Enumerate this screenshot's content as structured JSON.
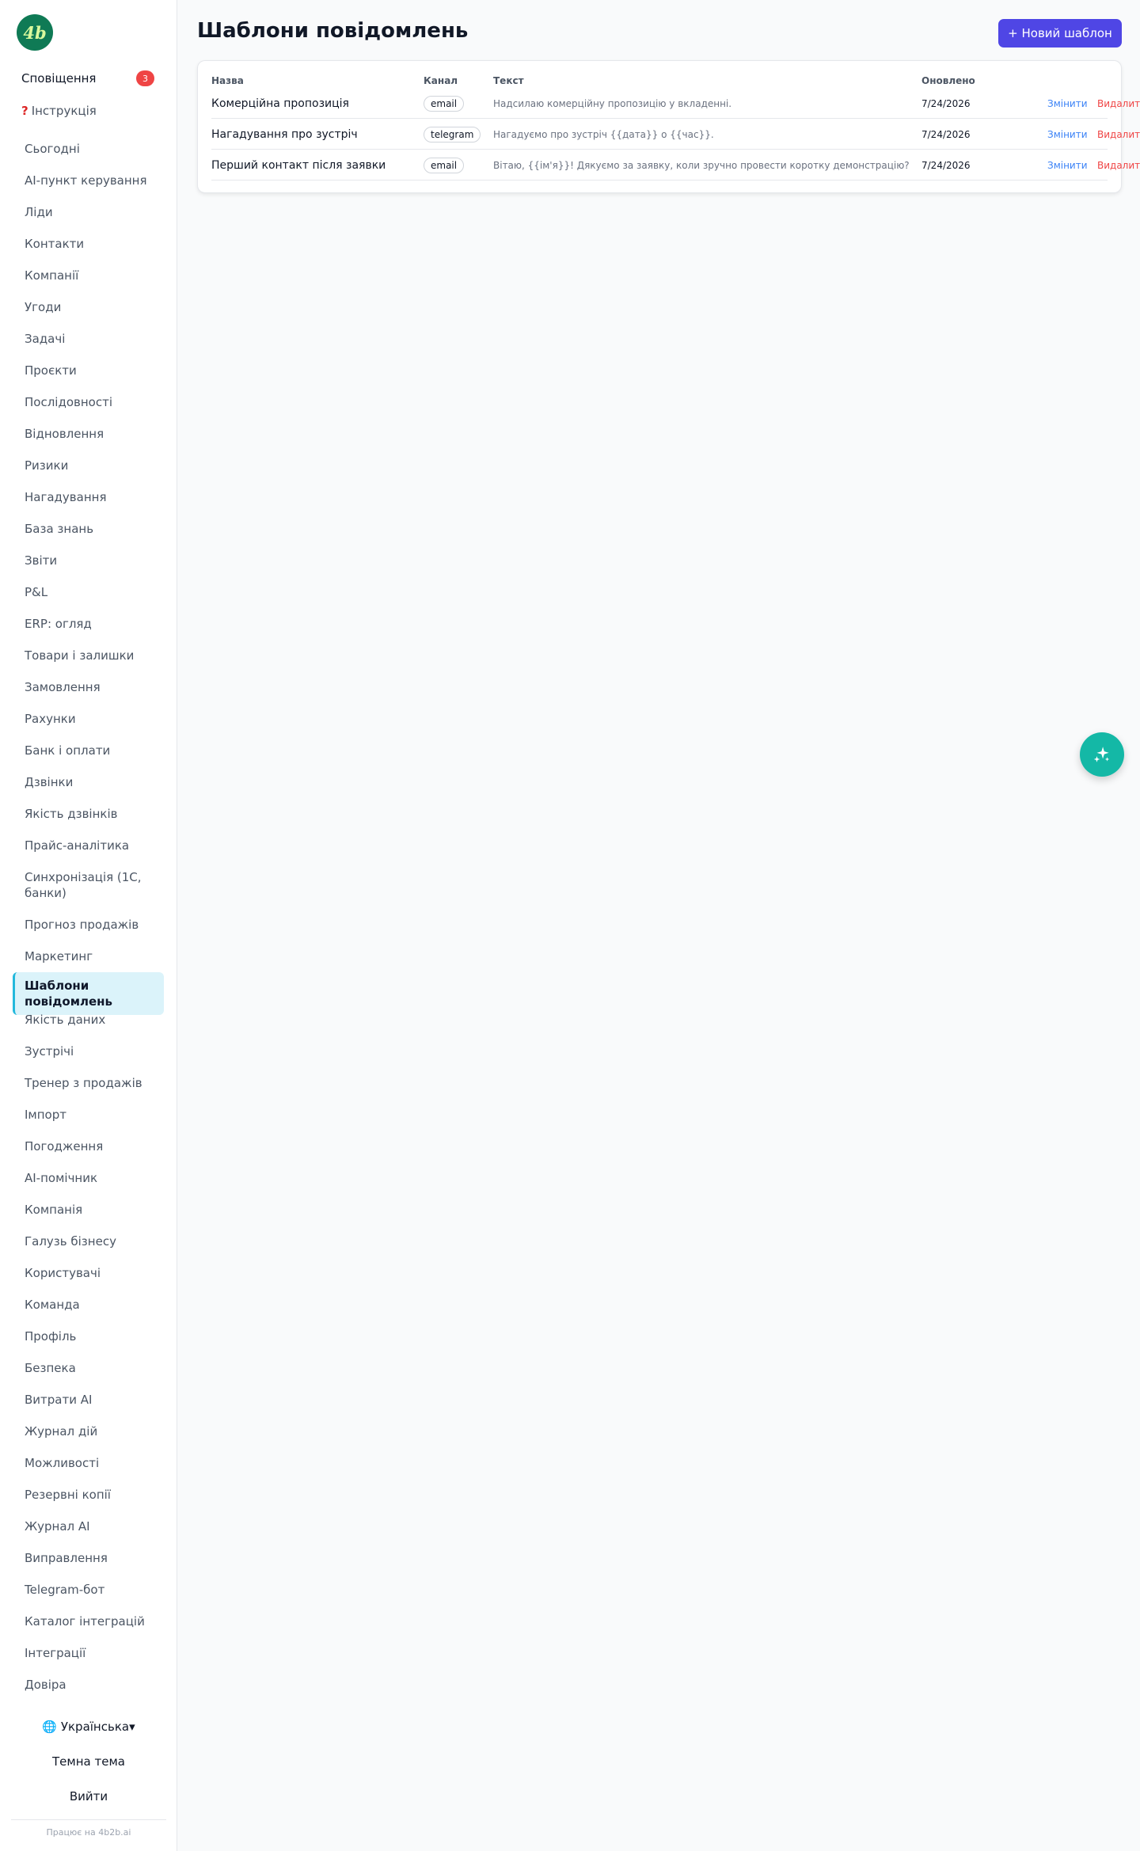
{
  "logo": {
    "text": "4b"
  },
  "sidebar": {
    "notifications": {
      "label": "Сповіщення",
      "count": "3"
    },
    "instruction": {
      "icon": "question-icon",
      "label": "Інструкція"
    },
    "items": [
      "Сьогодні",
      "AI-пункт керування",
      "Ліди",
      "Контакти",
      "Компанії",
      "Угоди",
      "Задачі",
      "Проєкти",
      "Послідовності",
      "Відновлення",
      "Ризики",
      "Нагадування",
      "База знань",
      "Звіти",
      "P&L",
      "ERP: огляд",
      "Товари і залишки",
      "Замовлення",
      "Рахунки",
      "Банк і оплати",
      "Дзвінки",
      "Якість дзвінків",
      "Прайс-аналітика",
      "Синхронізація (1С, банки)",
      "Прогноз продажів",
      "Маркетинг",
      "Шаблони повідомлень",
      "Якість даних",
      "Зустрічі",
      "Тренер з продажів",
      "Імпорт",
      "Погодження",
      "AI-помічник",
      "Компанія",
      "Галузь бізнесу",
      "Користувачі",
      "Команда",
      "Профіль",
      "Безпека",
      "Витрати AI",
      "Журнал дій",
      "Можливості",
      "Резервні копії",
      "Журнал AI",
      "Виправлення",
      "Telegram-бот",
      "Каталог інтеграцій",
      "Інтеграції",
      "Довіра"
    ],
    "active_item": "Шаблони повідомлень",
    "language": {
      "icon": "globe-icon",
      "label": "Українська",
      "caret": "▾"
    },
    "theme_label": "Темна тема",
    "logout_label": "Вийти",
    "powered_by": "Працює на 4b2b.ai"
  },
  "header": {
    "title": "Шаблони повідомлень",
    "new_button": "+ Новий шаблон"
  },
  "table": {
    "columns": [
      "Назва",
      "Канал",
      "Текст",
      "Оновлено"
    ],
    "rows": [
      {
        "name": "Комерційна пропозиція",
        "channel": "email",
        "text": "Надсилаю комерційну пропозицію у вкладенні.",
        "updated": "7/24/2026",
        "edit": "Змінити",
        "delete": "Видалити"
      },
      {
        "name": "Нагадування про зустріч",
        "channel": "telegram",
        "text": "Нагадуємо про зустріч {{дата}} о {{час}}.",
        "updated": "7/24/2026",
        "edit": "Змінити",
        "delete": "Видалити"
      },
      {
        "name": "Перший контакт після заявки",
        "channel": "email",
        "text": "Вітаю, {{ім'я}}! Дякуємо за заявку, коли зручно провести коротку демонстрацію?",
        "updated": "7/24/2026",
        "edit": "Змінити",
        "delete": "Видалити"
      }
    ]
  },
  "fab": {
    "icon": "sparkles-icon"
  },
  "colors": {
    "accent": "#4f46e5",
    "active_bg": "#dbf3fa",
    "active_border": "#22b8dc",
    "fab": "#14b8a6",
    "danger": "#ef4444",
    "link": "#3b82f6",
    "logo": "#0f7a55"
  }
}
